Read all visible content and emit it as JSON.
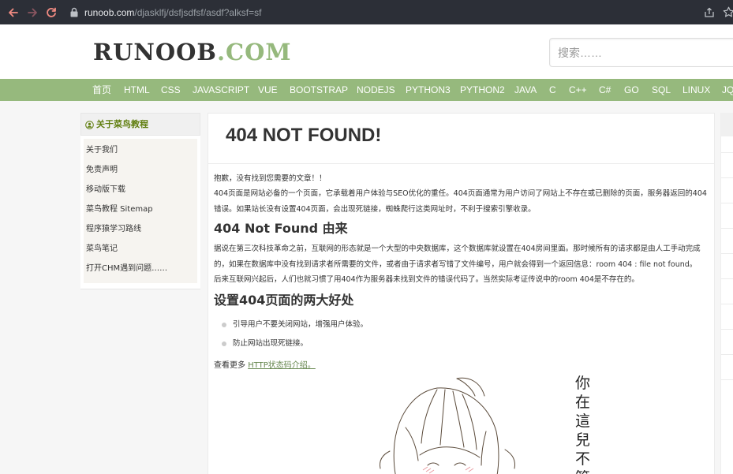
{
  "browser": {
    "url_domain": "runoob.com",
    "url_path": "/djasklfj/dsfjsdfsf/asdf?alksf=sf",
    "icons": [
      "back-icon",
      "forward-icon",
      "reload-icon",
      "lock-icon",
      "share-icon",
      "star-icon"
    ]
  },
  "header": {
    "logo_main": "RUNOOB",
    "logo_suffix": ".COM",
    "search_placeholder": "搜索……"
  },
  "nav": {
    "items": [
      "首页",
      "HTML",
      "CSS",
      "JAVASCRIPT",
      "VUE",
      "BOOTSTRAP",
      "NODEJS",
      "PYTHON3",
      "PYTHON2",
      "JAVA",
      "C",
      "C++",
      "C#",
      "GO",
      "SQL",
      "LINUX",
      "JQ"
    ]
  },
  "sidebar": {
    "title": "关于菜鸟教程",
    "items": [
      "关于我们",
      "免责声明",
      "移动版下载",
      "菜鸟教程 Sitemap",
      "程序猿学习路线",
      "菜鸟笔记",
      "打开CHM遇到问题……"
    ]
  },
  "article": {
    "title": "404 NOT FOUND!",
    "p1": "抱歉，没有找到您需要的文章！！",
    "p2": "404页面是网站必备的一个页面，它承载着用户体验与SEO优化的重任。404页面通常为用户访问了网站上不存在或已删除的页面，服务器返回的404错误。如果站长没有设置404页面，会出现死链接，蜘蛛爬行这类网址时，不利于搜索引擎收录。",
    "h2a": "404 Not Found 由来",
    "p3": "据说在第三次科技革命之前，互联网的形态就是一个大型的中央数据库，这个数据库就设置在404房间里面。那时候所有的请求都是由人工手动完成的，如果在数据库中没有找到请求者所需要的文件，或者由于请求者写错了文件编号，用户就会得到一个返回信息：room 404 : file not found。",
    "p4": "后来互联网兴起后，人们也就习惯了用404作为服务器未找到文件的错误代码了。当然实际考证传说中的room 404是不存在的。",
    "h2b": "设置404页面的两大好处",
    "bullets": [
      "引导用户不要关闭网站，增强用户体验。",
      "防止网站出现死链接。"
    ],
    "more_prefix": "查看更多 ",
    "more_link": "HTTP状态码介绍。",
    "illustration_text": "你在這兒不管"
  },
  "colors": {
    "brand_green": "#96b97d",
    "link_green": "#64854c",
    "sidebar_title": "#617f10",
    "chrome_bg": "#2c2f37"
  }
}
